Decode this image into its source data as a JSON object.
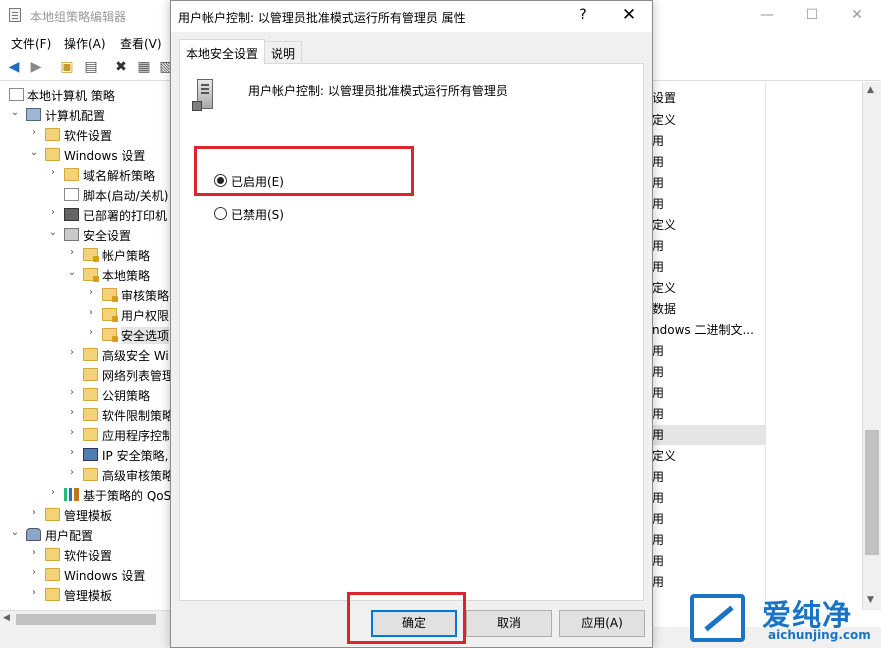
{
  "background_window": {
    "title": "本地组策略编辑器",
    "minimize_glyph": "—",
    "maximize_glyph": "☐",
    "close_glyph": "✕",
    "menu": [
      "文件(F)",
      "操作(A)",
      "查看(V)"
    ],
    "toolbar_icons": [
      "back-arrow-icon",
      "forward-arrow-icon",
      "up-folder-icon",
      "show-hide-tree-icon",
      "delete-icon",
      "properties-icon",
      "export-icon"
    ],
    "toolbar_glyphs": {
      "back": "◀",
      "forward": "▶",
      "up": "▣",
      "tree": "▤",
      "delete": "✖",
      "properties": "▦",
      "export": "▧"
    },
    "tree": [
      {
        "label": "本地计算机 策略",
        "arrow": "",
        "icon": "doc"
      },
      {
        "label": "计算机配置",
        "arrow": "⌄",
        "icon": "computer"
      },
      {
        "label": "软件设置",
        "arrow": "›",
        "icon": "folder"
      },
      {
        "label": "Windows 设置",
        "arrow": "⌄",
        "icon": "folder"
      },
      {
        "label": "域名解析策略",
        "arrow": "›",
        "icon": "folder"
      },
      {
        "label": "脚本(启动/关机)",
        "arrow": "",
        "icon": "doc"
      },
      {
        "label": "已部署的打印机",
        "arrow": "›",
        "icon": "printer"
      },
      {
        "label": "安全设置",
        "arrow": "⌄",
        "icon": "shield"
      },
      {
        "label": "帐户策略",
        "arrow": "›",
        "icon": "folder-lock"
      },
      {
        "label": "本地策略",
        "arrow": "⌄",
        "icon": "folder-lock"
      },
      {
        "label": "审核策略",
        "arrow": "›",
        "icon": "folder-lock"
      },
      {
        "label": "用户权限",
        "arrow": "›",
        "icon": "folder-lock"
      },
      {
        "label": "安全选项",
        "arrow": "›",
        "icon": "folder-lock"
      },
      {
        "label": "高级安全 Wi",
        "arrow": "›",
        "icon": "folder"
      },
      {
        "label": "网络列表管理",
        "arrow": "",
        "icon": "folder"
      },
      {
        "label": "公钥策略",
        "arrow": "›",
        "icon": "folder"
      },
      {
        "label": "软件限制策略",
        "arrow": "›",
        "icon": "folder"
      },
      {
        "label": "应用程序控制",
        "arrow": "›",
        "icon": "folder"
      },
      {
        "label": "IP 安全策略,",
        "arrow": "›",
        "icon": "netico"
      },
      {
        "label": "高级审核策略",
        "arrow": "›",
        "icon": "folder"
      },
      {
        "label": "基于策略的 QoS",
        "arrow": "›",
        "icon": "bars"
      },
      {
        "label": "管理模板",
        "arrow": "›",
        "icon": "folder"
      },
      {
        "label": "用户配置",
        "arrow": "⌄",
        "icon": "users"
      },
      {
        "label": "软件设置",
        "arrow": "›",
        "icon": "folder"
      },
      {
        "label": "Windows 设置",
        "arrow": "›",
        "icon": "folder"
      },
      {
        "label": "管理模板",
        "arrow": "›",
        "icon": "folder"
      }
    ],
    "list_items": [
      "设置",
      "定义",
      "用",
      "用",
      "用",
      "用",
      "定义",
      "用",
      "用",
      "定义",
      "数据",
      "ndows 二进制文...",
      "用",
      "用",
      "用",
      "用",
      "用",
      "定义",
      "用",
      "用",
      "用",
      "用",
      "用",
      "用"
    ]
  },
  "dialog": {
    "title": "用户帐户控制: 以管理员批准模式运行所有管理员 属性",
    "help_glyph": "?",
    "close_glyph": "✕",
    "tabs": [
      "本地安全设置",
      "说明"
    ],
    "policy_name": "用户帐户控制: 以管理员批准模式运行所有管理员",
    "options": [
      {
        "label": "已启用(E)",
        "checked": true
      },
      {
        "label": "已禁用(S)",
        "checked": false
      }
    ],
    "buttons": {
      "ok": "确定",
      "cancel": "取消",
      "apply": "应用(A)"
    }
  },
  "watermark": {
    "name_cn": "爱纯净",
    "url": "aichunjing.com"
  },
  "colors": {
    "highlight_red": "#d9262c",
    "focus_blue": "#0078d7",
    "watermark_blue": "#1a73c4"
  }
}
